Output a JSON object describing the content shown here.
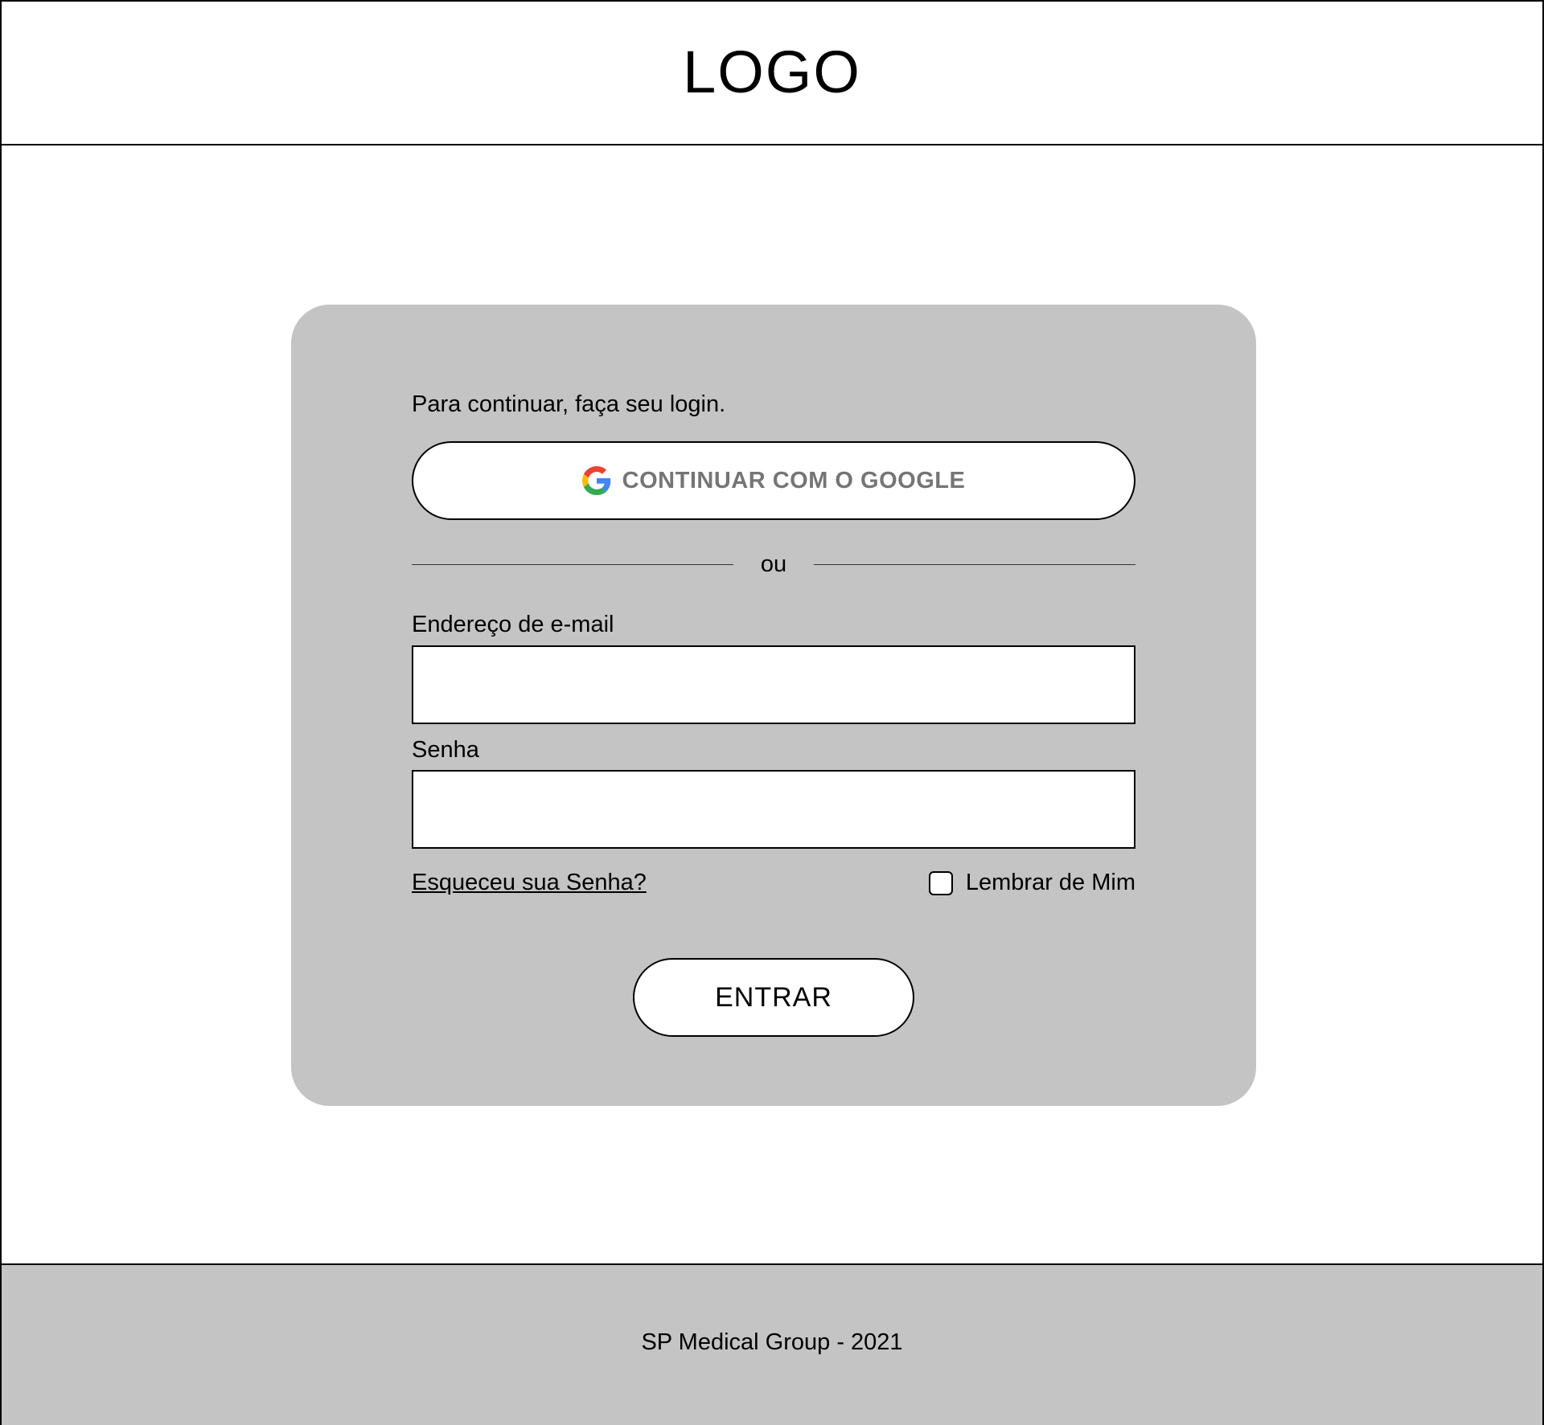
{
  "header": {
    "logo_text": "LOGO"
  },
  "login": {
    "intro_text": "Para continuar, faça seu login.",
    "google_button_label": "CONTINUAR COM O GOOGLE",
    "google_icon": "google-g-icon",
    "divider_text": "ou",
    "email_label": "Endereço de e-mail",
    "email_value": "",
    "password_label": "Senha",
    "password_value": "",
    "forgot_password_link": "Esqueceu sua Senha?",
    "remember_me_label": "Lembrar de Mim",
    "remember_me_checked": false,
    "submit_label": "ENTRAR"
  },
  "footer": {
    "text": "SP Medical Group - 2021"
  },
  "colors": {
    "card_background": "#c4c4c4",
    "footer_background": "#c4c4c4",
    "google_label": "#757575",
    "page_background": "#ffffff",
    "border": "#000000"
  }
}
